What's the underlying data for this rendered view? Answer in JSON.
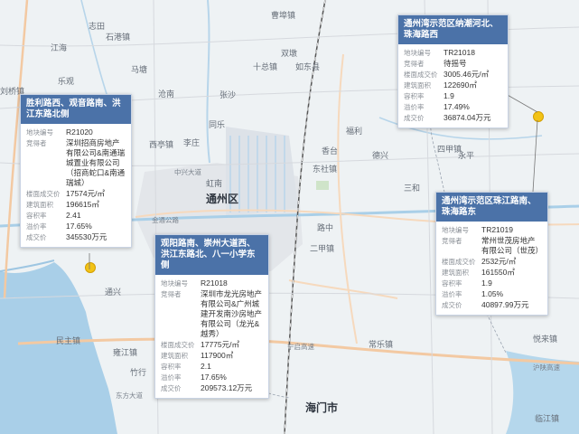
{
  "map": {
    "city_labels": [
      {
        "text": "通州区"
      },
      {
        "text": "海门市"
      }
    ],
    "town_labels": [
      {
        "text": "曹埠镇"
      },
      {
        "text": "石港镇"
      },
      {
        "text": "志田"
      },
      {
        "text": "江海"
      },
      {
        "text": "马塘"
      },
      {
        "text": "刘桥镇"
      },
      {
        "text": "乐观"
      },
      {
        "text": "沧南"
      },
      {
        "text": "张沙"
      },
      {
        "text": "双墩"
      },
      {
        "text": "十总镇"
      },
      {
        "text": "如东县"
      },
      {
        "text": "同乐"
      },
      {
        "text": "西亭镇"
      },
      {
        "text": "李庄"
      },
      {
        "text": "福利"
      },
      {
        "text": "东社镇"
      },
      {
        "text": "香台"
      },
      {
        "text": "四甲镇"
      },
      {
        "text": "永平"
      },
      {
        "text": "三和"
      },
      {
        "text": "德兴"
      },
      {
        "text": "虹南"
      },
      {
        "text": "路中"
      },
      {
        "text": "二甲镇"
      },
      {
        "text": "常乐镇"
      },
      {
        "text": "民主镇"
      },
      {
        "text": "竹行"
      },
      {
        "text": "通兴"
      },
      {
        "text": "悦来镇"
      },
      {
        "text": "临江镇"
      },
      {
        "text": "雍江镇"
      },
      {
        "text": "旭丰"
      },
      {
        "text": "东方大道"
      },
      {
        "text": "金通公路"
      },
      {
        "text": "中兴大道"
      },
      {
        "text": "沪陕高速"
      },
      {
        "text": "宁启高速"
      }
    ]
  },
  "parcels": [
    {
      "title": "通州湾示范区纳潮河北、珠海路西",
      "rows": [
        {
          "k": "地块编号",
          "v": "TR21018"
        },
        {
          "k": "竞得者",
          "v": "待摇号"
        },
        {
          "k": "楼面成交价",
          "v": "3005.46元/㎡"
        },
        {
          "k": "建筑面积",
          "v": "122690㎡"
        },
        {
          "k": "容积率",
          "v": "1.9"
        },
        {
          "k": "溢价率",
          "v": "17.49%"
        },
        {
          "k": "成交价",
          "v": "36874.04万元"
        }
      ]
    },
    {
      "title": "胜利路西、观音路南、洪江东路北侧",
      "rows": [
        {
          "k": "地块编号",
          "v": "R21020"
        },
        {
          "k": "竞得者",
          "v": "深圳招商房地产有限公司&南通瑞城置业有限公司（招商蛇口&南通瑞城）"
        },
        {
          "k": "楼面成交价",
          "v": "17574元/㎡"
        },
        {
          "k": "建筑面积",
          "v": "196615㎡"
        },
        {
          "k": "容积率",
          "v": "2.41"
        },
        {
          "k": "溢价率",
          "v": "17.65%"
        },
        {
          "k": "成交价",
          "v": "345530万元"
        }
      ]
    },
    {
      "title": "通州湾示范区珠江路南、珠海路东",
      "rows": [
        {
          "k": "地块编号",
          "v": "TR21019"
        },
        {
          "k": "竞得者",
          "v": "常州世茂房地产有限公司（世茂）"
        },
        {
          "k": "楼面成交价",
          "v": "2532元/㎡"
        },
        {
          "k": "建筑面积",
          "v": "161550㎡"
        },
        {
          "k": "容积率",
          "v": "1.9"
        },
        {
          "k": "溢价率",
          "v": "1.05%"
        },
        {
          "k": "成交价",
          "v": "40897.99万元"
        }
      ]
    },
    {
      "title": "观阳路南、崇州大道西、洪江东路北、八一小学东侧",
      "rows": [
        {
          "k": "地块编号",
          "v": "R21018"
        },
        {
          "k": "竞得者",
          "v": "深圳市龙光房地产有限公司&广州城建开发南沙房地产有限公司（龙光&越秀）"
        },
        {
          "k": "楼面成交价",
          "v": "17775元/㎡"
        },
        {
          "k": "建筑面积",
          "v": "117900㎡"
        },
        {
          "k": "容积率",
          "v": "2.1"
        },
        {
          "k": "溢价率",
          "v": "17.65%"
        },
        {
          "k": "成交价",
          "v": "209573.12万元"
        }
      ]
    }
  ]
}
